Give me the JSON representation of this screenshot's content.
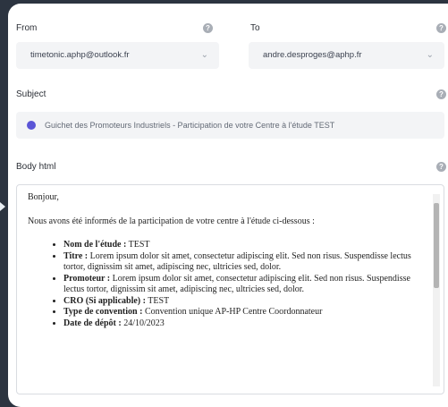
{
  "from": {
    "label": "From",
    "value": "timetonic.aphp@outlook.fr"
  },
  "to": {
    "label": "To",
    "value": "andre.desproges@aphp.fr"
  },
  "subject": {
    "label": "Subject",
    "value": "Guichet des Promoteurs Industriels - Participation de votre Centre à l'étude TEST"
  },
  "body": {
    "label": "Body html",
    "greeting": "Bonjour,",
    "intro": "Nous avons été informés de la participation de votre centre à l'étude ci-dessous :",
    "items": [
      {
        "key": "Nom de l'étude :",
        "value": " TEST"
      },
      {
        "key": "Titre :",
        "value": " Lorem ipsum dolor sit amet, consectetur adipiscing elit. Sed non risus. Suspendisse lectus tortor, dignissim sit amet, adipiscing nec, ultricies sed, dolor."
      },
      {
        "key": "Promoteur :",
        "value": " Lorem ipsum dolor sit amet, consectetur adipiscing elit. Sed non risus. Suspendisse lectus tortor, dignissim sit amet, adipiscing nec, ultricies sed, dolor."
      },
      {
        "key": "CRO (Si applicable) :",
        "value": " TEST"
      },
      {
        "key": "Type de convention :",
        "value": " Convention unique AP-HP Centre Coordonnateur"
      },
      {
        "key": "Date de dépôt :",
        "value": " 24/10/2023"
      }
    ]
  },
  "colors": {
    "background": "#2c3440",
    "field_bg": "#f3f4f6",
    "subject_dot": "#5b55d6"
  },
  "icons": [
    "help-icon",
    "chevron-down-icon",
    "scrollbar"
  ]
}
